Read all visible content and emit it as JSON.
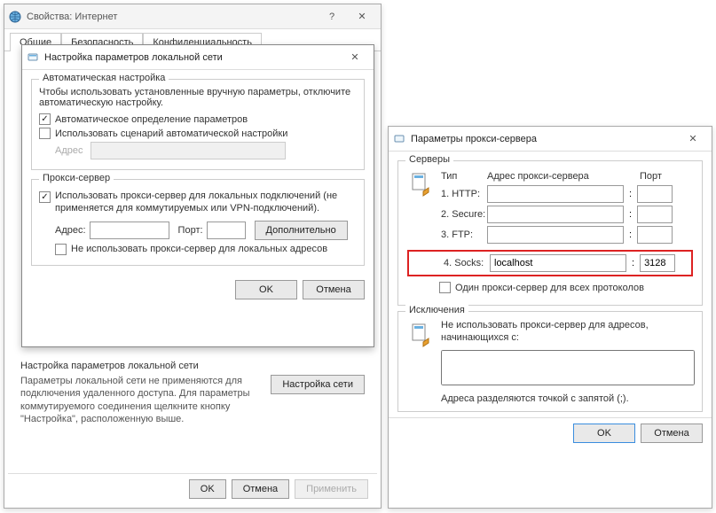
{
  "internet_props": {
    "title": "Свойства: Интернет",
    "tabs": {
      "general": "Общие",
      "security": "Безопасность",
      "privacy": "Конфиденциальность"
    },
    "lan_section_title": "Настройка параметров локальной сети",
    "lan_text": "Параметры локальной сети не применяются для подключения удаленного доступа. Для параметры коммутируемого соединения щелкните кнопку \"Настройка\", расположенную выше.",
    "lan_button": "Настройка сети",
    "ok": "OK",
    "cancel": "Отмена",
    "apply": "Применить"
  },
  "lan_dialog": {
    "title": "Настройка параметров локальной сети",
    "auto_group": "Автоматическая настройка",
    "auto_text": "Чтобы использовать установленные вручную параметры, отключите автоматическую настройку.",
    "auto_detect": "Автоматическое определение параметров",
    "use_script": "Использовать сценарий автоматической настройки",
    "address_lbl": "Адрес",
    "proxy_group": "Прокси-сервер",
    "use_proxy": "Использовать прокси-сервер для локальных подключений (не применяется для коммутируемых или VPN-подключений).",
    "address": "Адрес:",
    "port": "Порт:",
    "advanced": "Дополнительно",
    "bypass_local": "Не использовать прокси-сервер для локальных адресов",
    "ok": "OK",
    "cancel": "Отмена"
  },
  "proxy_dialog": {
    "title": "Параметры прокси-сервера",
    "servers_group": "Серверы",
    "col_type": "Тип",
    "col_addr": "Адрес прокси-сервера",
    "col_port": "Порт",
    "types": {
      "http": "1. HTTP:",
      "secure": "2. Secure:",
      "ftp": "3. FTP:",
      "socks": "4. Socks:"
    },
    "values": {
      "http_addr": "",
      "http_port": "",
      "secure_addr": "",
      "secure_port": "",
      "ftp_addr": "",
      "ftp_port": "",
      "socks_addr": "localhost",
      "socks_port": "3128"
    },
    "same_proxy": "Один прокси-сервер для всех протоколов",
    "exceptions_group": "Исключения",
    "exceptions_text": "Не использовать прокси-сервер для адресов, начинающихся с:",
    "exceptions_hint": "Адреса разделяются точкой с запятой (;).",
    "ok": "OK",
    "cancel": "Отмена"
  }
}
